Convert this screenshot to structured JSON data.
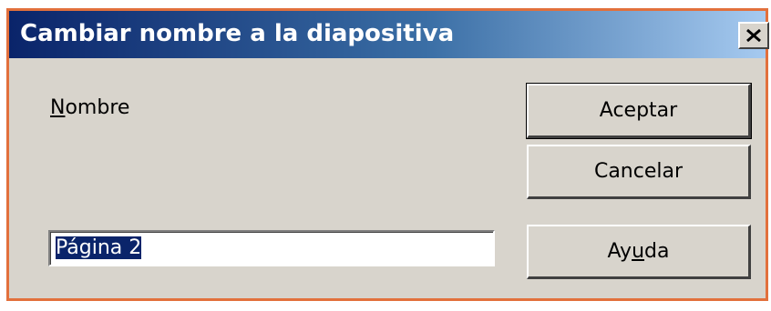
{
  "dialog": {
    "title": "Cambiar nombre a la diapositiva",
    "close_glyph": "X",
    "name_label_first": "N",
    "name_label_rest": "ombre",
    "name_value": "Página 2",
    "buttons": {
      "ok": "Aceptar",
      "cancel": "Cancelar",
      "help_part1": "Ay",
      "help_underlined": "u",
      "help_part2": "da"
    }
  },
  "colors": {
    "titlebar_start": "#0a246a",
    "titlebar_end": "#a6caf0",
    "dialog_bg": "#d8d4cc",
    "frame_border": "#e2703c",
    "selection": "#0a246a"
  },
  "icons": {
    "close": "close-icon"
  }
}
